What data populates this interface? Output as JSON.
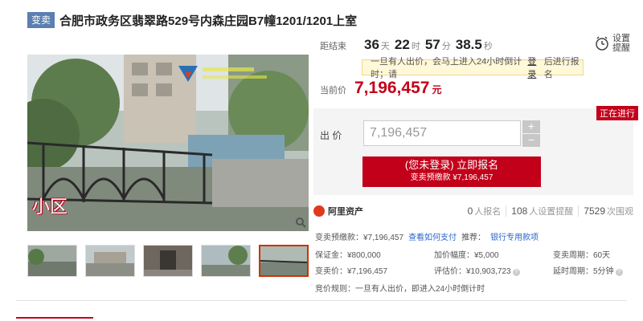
{
  "header": {
    "tag": "变卖",
    "title": "合肥市政务区翡翠路529号内森庄园B7幢1201/1201上室"
  },
  "photo": {
    "caption": "小区"
  },
  "timer": {
    "label": "距结束",
    "days": "36",
    "days_unit": "天",
    "hours": "22",
    "hours_unit": "时",
    "minutes": "57",
    "minutes_unit": "分",
    "seconds": "38.5",
    "seconds_unit": "秒"
  },
  "reminder": {
    "label": "设置提醒"
  },
  "notice": {
    "prefix": "一旦有人出价，会马上进入24小时倒计时；请",
    "link": "登录",
    "suffix": "后进行报名"
  },
  "price": {
    "label": "当前价",
    "value": "7,196,457",
    "unit": "元"
  },
  "status": {
    "badge": "正在进行"
  },
  "bid": {
    "label": "出 价",
    "value": "7,196,457",
    "plus": "+",
    "minus": "−",
    "button_main": "(您未登录) 立即报名",
    "button_sub": "变卖预缴款 ¥7,196,457"
  },
  "stats": {
    "brand": "阿里资产",
    "signup_count": "0",
    "signup_label": "人报名",
    "remind_count": "108",
    "remind_label": "人设置提醒",
    "view_count": "7529",
    "view_label": "次围观"
  },
  "deposit": {
    "text": "变卖预缴款：¥7,196,457",
    "link1": "查看如何支付",
    "recommend": "推荐：",
    "link2": "银行专用款项"
  },
  "info": {
    "row1": {
      "a": "保证金：¥800,000",
      "b": "加价幅度：¥5,000",
      "c": "变卖周期：60天"
    },
    "row2": {
      "a": "变卖价：¥7,196,457",
      "b": "评估价：¥10,903,723",
      "c": "延时周期：5分钟"
    },
    "help": "?"
  },
  "rule": {
    "text": "竞价规则：一旦有人出价，即进入24小时倒计时"
  },
  "colors": {
    "accent": "#c3001a",
    "link": "#2b66c9",
    "tag": "#5b7fb0"
  }
}
